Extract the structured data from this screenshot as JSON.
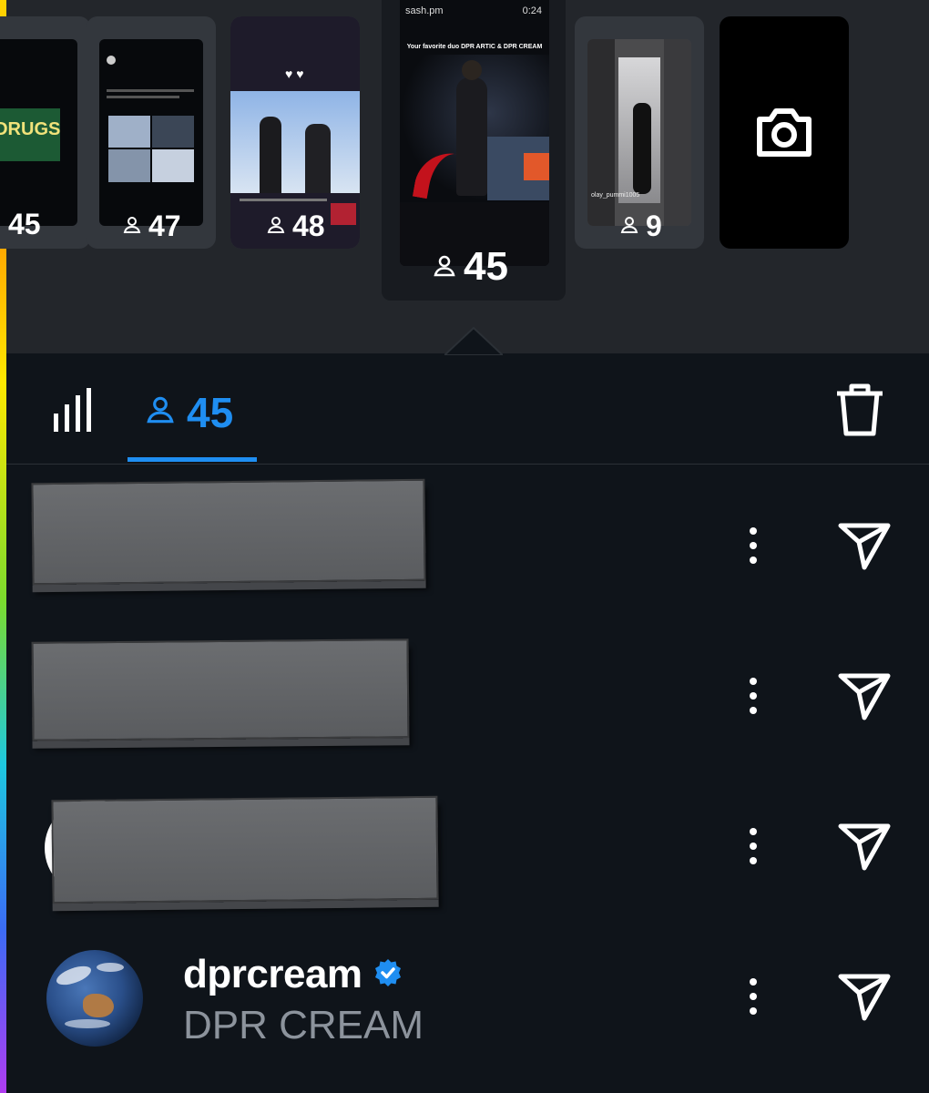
{
  "story_tray": {
    "cards": [
      {
        "viewers": "45",
        "caption": "O DRUGS"
      },
      {
        "viewers": "47"
      },
      {
        "viewers": "48"
      },
      {
        "viewers": "9",
        "caption": "olay_pummi1005"
      }
    ],
    "selected": {
      "viewers": "45",
      "account": "sash.pm",
      "time": "0:24",
      "overlay_text": "Your favorite duo DPR ARTIC & DPR CREAM"
    }
  },
  "tabs": {
    "insights_icon": "bar-chart-icon",
    "viewers_count": "45",
    "active": "viewers"
  },
  "viewers": [
    {
      "redacted": true
    },
    {
      "redacted": true
    },
    {
      "redacted": true
    },
    {
      "username": "dprcream",
      "verified": true,
      "full_name": "DPR CREAM"
    }
  ],
  "colors": {
    "accent": "#1f8ef1",
    "verified": "#1f8ef1",
    "background": "#0f141a"
  }
}
